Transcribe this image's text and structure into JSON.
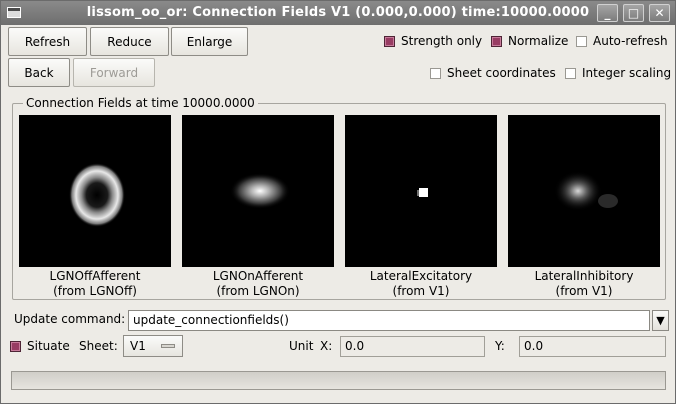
{
  "window": {
    "title": "lissom_oo_or: Connection Fields V1 (0.000,0.000) time:10000.0000",
    "controls": {
      "minimize": "_",
      "maximize": "□",
      "close": "✕"
    }
  },
  "toolbar": {
    "refresh_label": "Refresh",
    "reduce_label": "Reduce",
    "enlarge_label": "Enlarge",
    "back_label": "Back",
    "forward_label": "Forward"
  },
  "options": {
    "strength_only": {
      "label": "Strength only",
      "checked": true
    },
    "normalize": {
      "label": "Normalize",
      "checked": true
    },
    "auto_refresh": {
      "label": "Auto-refresh",
      "checked": false
    },
    "sheet_coordinates": {
      "label": "Sheet coordinates",
      "checked": false
    },
    "integer_scaling": {
      "label": "Integer scaling",
      "checked": false
    }
  },
  "group_label": "Connection Fields at time 10000.0000",
  "fields": [
    {
      "name": "LGNOffAfferent",
      "source": "(from LGNOff)",
      "pattern": "ring-icon"
    },
    {
      "name": "LGNOnAfferent",
      "source": "(from LGNOn)",
      "pattern": "blob-icon"
    },
    {
      "name": "LateralExcitatory",
      "source": "(from V1)",
      "pattern": "dot-icon"
    },
    {
      "name": "LateralInhibitory",
      "source": "(from V1)",
      "pattern": "faint-blob-icon"
    }
  ],
  "update_command": {
    "label": "Update command:",
    "value": "update_connectionfields()"
  },
  "situate": {
    "label": "Situate",
    "checked": true
  },
  "sheet": {
    "label": "Sheet:",
    "value": "V1"
  },
  "unit": {
    "label": "Unit",
    "x_label": "X:",
    "x_value": "0.0",
    "y_label": "Y:",
    "y_value": "0.0"
  },
  "colors": {
    "accent": "#983c63",
    "background": "#edebe6",
    "titlebar": "#7a7a7a"
  }
}
